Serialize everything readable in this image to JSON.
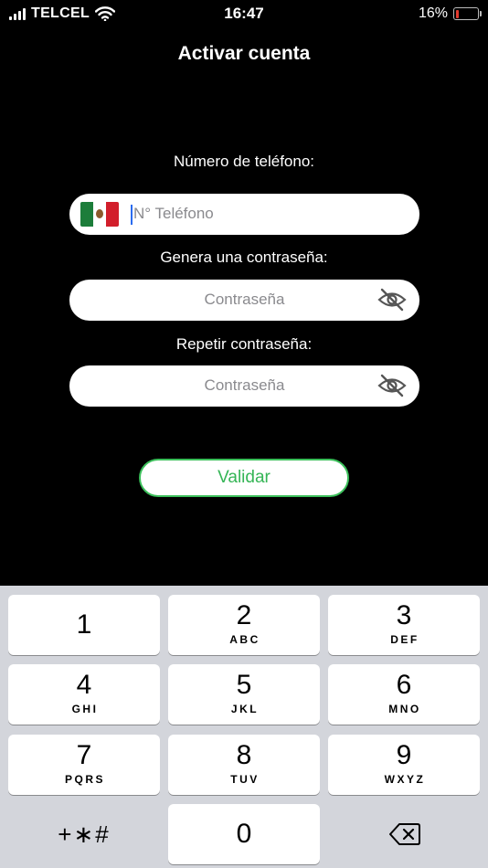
{
  "status_bar": {
    "carrier": "TELCEL",
    "time": "16:47",
    "battery": "16%",
    "battery_level": 0.16,
    "battery_color": "#e23a2e"
  },
  "title": "Activar cuenta",
  "phone": {
    "label": "Número de teléfono:",
    "placeholder": "N° Teléfono",
    "flag_icon": "mexico-flag-icon"
  },
  "password": {
    "label": "Genera una contraseña:",
    "placeholder": "Contraseña",
    "icon": "eye-off-icon"
  },
  "repeat_password": {
    "label": "Repetir contraseña:",
    "placeholder": "Contraseña",
    "icon": "eye-off-icon"
  },
  "validate_button": {
    "label": "Validar",
    "color": "#35b556"
  },
  "keypad": {
    "keys": [
      {
        "num": "1",
        "letters": ""
      },
      {
        "num": "2",
        "letters": "ABC"
      },
      {
        "num": "3",
        "letters": "DEF"
      },
      {
        "num": "4",
        "letters": "GHI"
      },
      {
        "num": "5",
        "letters": "JKL"
      },
      {
        "num": "6",
        "letters": "MNO"
      },
      {
        "num": "7",
        "letters": "PQRS"
      },
      {
        "num": "8",
        "letters": "TUV"
      },
      {
        "num": "9",
        "letters": "WXYZ"
      },
      {
        "num": "0",
        "letters": ""
      }
    ],
    "symbols": "+∗#",
    "delete_icon": "backspace-icon"
  }
}
